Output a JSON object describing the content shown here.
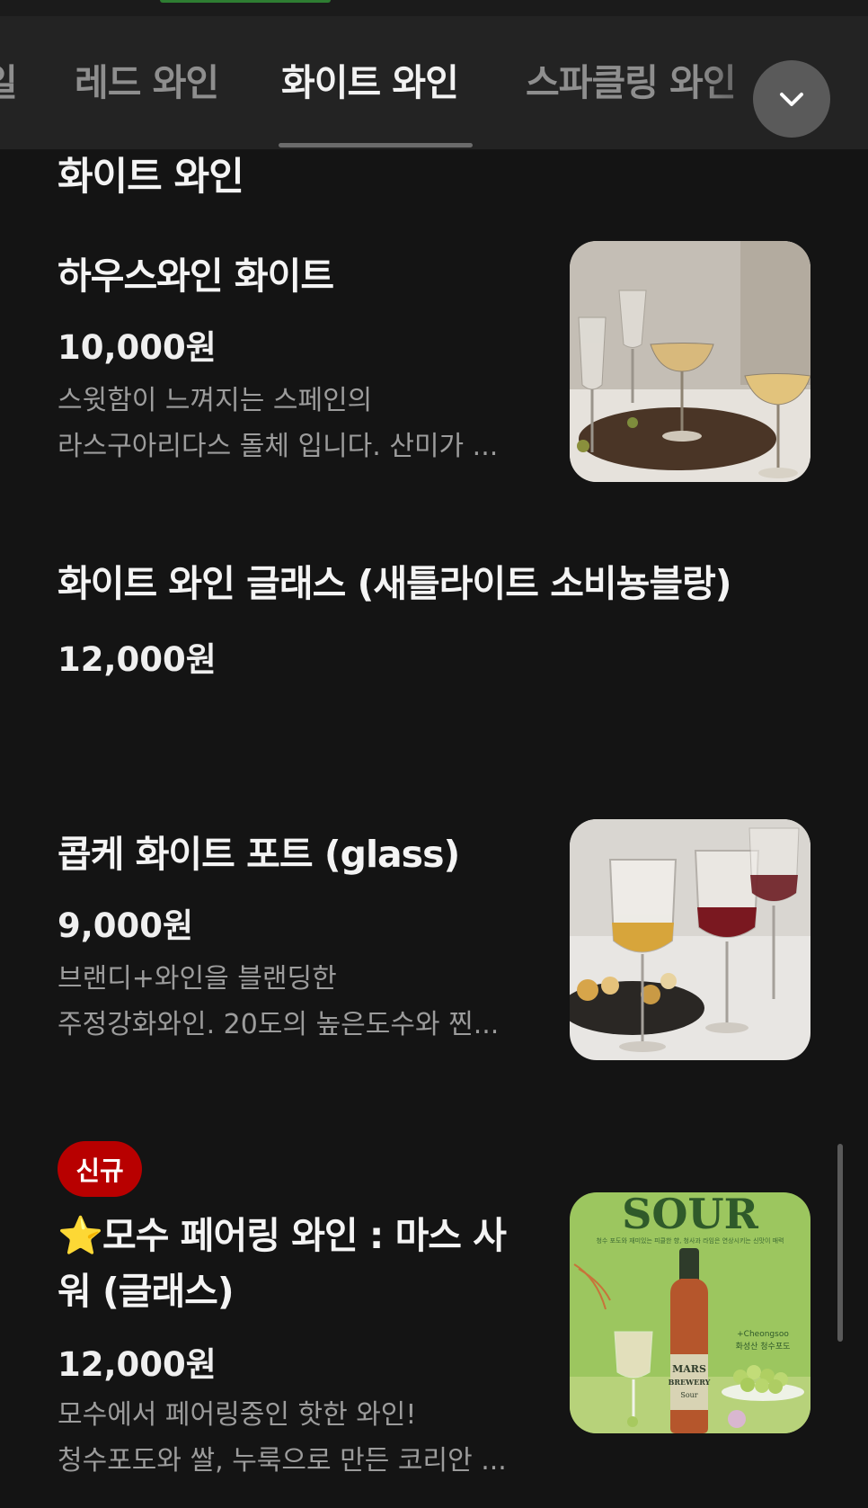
{
  "tabs": [
    {
      "label": "일"
    },
    {
      "label": "레드 와인"
    },
    {
      "label": "화이트 와인"
    },
    {
      "label": "스파클링 와인"
    }
  ],
  "active_tab": "화이트 와인",
  "section": {
    "title": "화이트 와인"
  },
  "items": [
    {
      "name": "하우스와인 화이트",
      "price": "10,000원",
      "desc_line1": "스윗함이 느껴지는 스페인의",
      "desc_line2": "라스구아리다스 돌체 입니다. 산미가 ..."
    },
    {
      "name": "화이트 와인 글래스 (새틀라이트 소비뇽블랑)",
      "price": "12,000원"
    },
    {
      "name": "콥케 화이트 포트 (glass)",
      "price": "9,000원",
      "desc_line1": "브랜디+와인을 블랜딩한",
      "desc_line2": "주정강화와인. 20도의 높은도수와 찐..."
    },
    {
      "badge": "신규",
      "name_line1": "⭐모수 페어링 와인 : 마스 사",
      "name_line2": "워 (글래스)",
      "price": "12,000원",
      "desc_line1": "모수에서 페어링중인 핫한 와인!",
      "desc_line2": "청수포도와 쌀, 누룩으로 만든 코리안 ..."
    }
  ],
  "sour_image": {
    "headline": "SOUR",
    "fine_print": "청수 포도와 재미있는 피클한 향, 청사과 라임은 연상시키는 신맛이 매력",
    "sub_en": "+Cheongsoo",
    "sub_kr": "화성산 청수포도",
    "bottle_l1": "MARS",
    "bottle_l2": "BREWERY",
    "bottle_l3": "Sour"
  },
  "colors": {
    "background": "#141414",
    "tabbar": "#232323",
    "badge": "#b80000",
    "muted_text": "#9c9c9c"
  }
}
